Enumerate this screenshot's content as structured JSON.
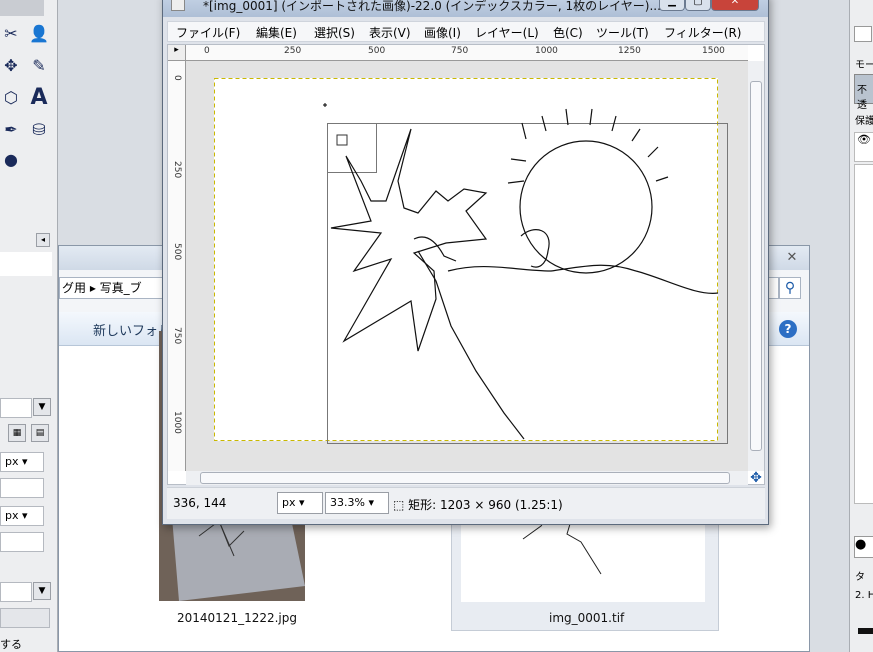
{
  "gimp": {
    "title": "*[img_0001] (インポートされた画像)-22.0 (インデックスカラー, 1枚のレイヤー)...",
    "menus": [
      "ファイル(F)",
      "編集(E)",
      "選択(S)",
      "表示(V)",
      "画像(I)",
      "レイヤー(L)",
      "色(C)",
      "ツール(T)",
      "フィルター(R)"
    ],
    "ruler_h": [
      "0",
      "250",
      "500",
      "750",
      "1000",
      "1250",
      "1500"
    ],
    "ruler_v": [
      "0",
      "250",
      "500",
      "750",
      "1000"
    ],
    "status": {
      "coords": "336, 144",
      "unit": "px",
      "zoom": "33.3%",
      "message": "矩形: 1203 × 960  (1.25:1)"
    }
  },
  "toolbox": {
    "unit1": "px",
    "unit2": "px",
    "bottom_text": "する"
  },
  "explorer": {
    "breadcrumb": "グ用  ▸  写真_ブ",
    "new_folder": "新しいフォル",
    "files": [
      {
        "name": "20140121_1222.jpg"
      },
      {
        "name": "img_0001.tif"
      }
    ]
  },
  "right_dock": {
    "mode_label": "モー",
    "mode_value": "不透",
    "protect_label": "保護",
    "tag_label": "タ",
    "brush_label": "2. H"
  }
}
